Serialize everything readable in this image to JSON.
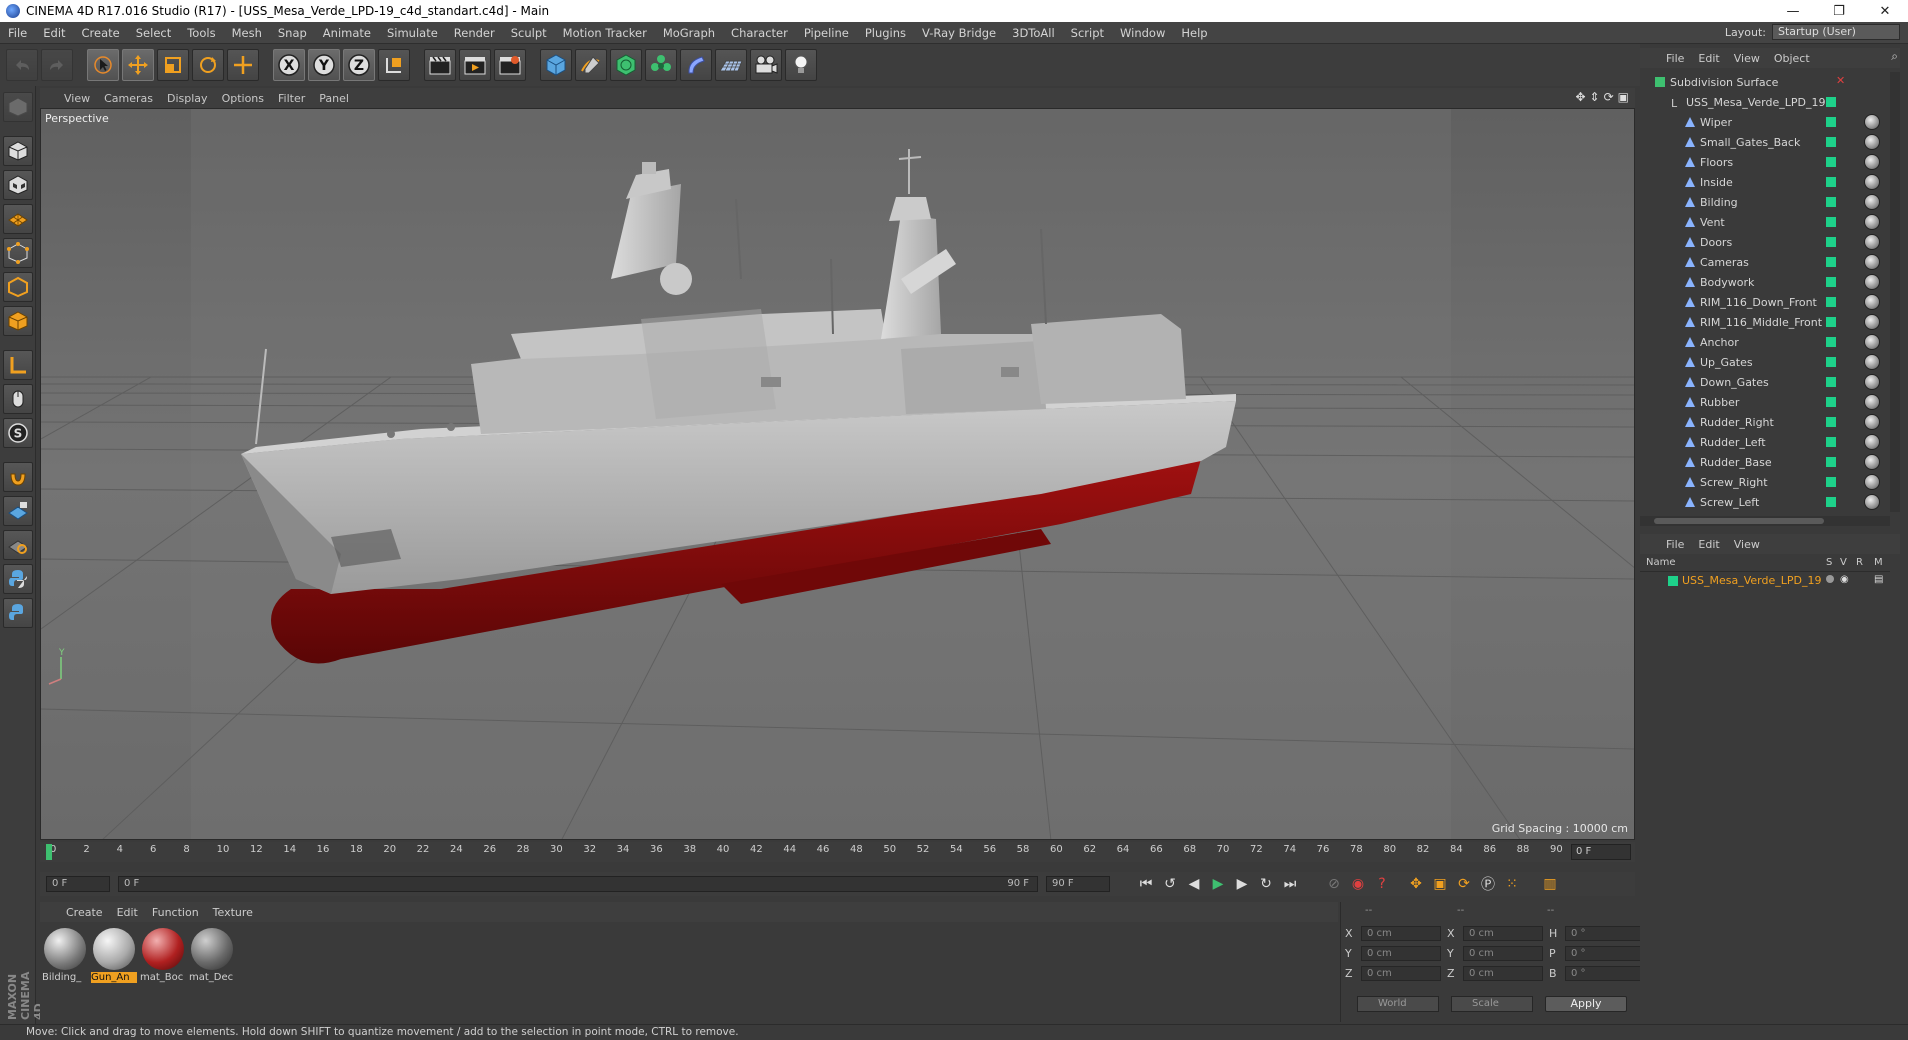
{
  "window": {
    "title": "CINEMA 4D R17.016 Studio (R17) - [USS_Mesa_Verde_LPD-19_c4d_standart.c4d] - Main",
    "minimize": "—",
    "restore": "❐",
    "close": "✕"
  },
  "menu": [
    "File",
    "Edit",
    "Create",
    "Select",
    "Tools",
    "Mesh",
    "Snap",
    "Animate",
    "Simulate",
    "Render",
    "Sculpt",
    "Motion Tracker",
    "MoGraph",
    "Character",
    "Pipeline",
    "Plugins",
    "V-Ray Bridge",
    "3DToAll",
    "Script",
    "Window",
    "Help"
  ],
  "layout": {
    "label": "Layout:",
    "value": "Startup (User)"
  },
  "viewport": {
    "menu": [
      "View",
      "Cameras",
      "Display",
      "Options",
      "Filter",
      "Panel"
    ],
    "label": "Perspective",
    "grid_spacing": "Grid Spacing : 10000 cm"
  },
  "timeline": {
    "ticks": [
      "0",
      "2",
      "4",
      "6",
      "8",
      "10",
      "12",
      "14",
      "16",
      "18",
      "20",
      "22",
      "24",
      "26",
      "28",
      "30",
      "32",
      "34",
      "36",
      "38",
      "40",
      "42",
      "44",
      "46",
      "48",
      "50",
      "52",
      "54",
      "56",
      "58",
      "60",
      "62",
      "64",
      "66",
      "68",
      "70",
      "72",
      "74",
      "76",
      "78",
      "80",
      "82",
      "84",
      "86",
      "88",
      "90"
    ],
    "current": "0 F",
    "start": "0 F",
    "range_start": "0 F",
    "range_end": "90 F",
    "end": "90 F"
  },
  "materials": {
    "menu": [
      "Create",
      "Edit",
      "Function",
      "Texture"
    ],
    "items": [
      {
        "label": "Bilding_",
        "selected": false
      },
      {
        "label": "Gun_An",
        "selected": true
      },
      {
        "label": "mat_Boc",
        "selected": false
      },
      {
        "label": "mat_Dec",
        "selected": false
      }
    ]
  },
  "coords": {
    "header": [
      "--",
      "--",
      "--"
    ],
    "rows": [
      {
        "a1": "X",
        "v1": "0 cm",
        "a2": "X",
        "v2": "0 cm",
        "a3": "H",
        "v3": "0 °"
      },
      {
        "a1": "Y",
        "v1": "0 cm",
        "a2": "Y",
        "v2": "0 cm",
        "a3": "P",
        "v3": "0 °"
      },
      {
        "a1": "Z",
        "v1": "0 cm",
        "a2": "Z",
        "v2": "0 cm",
        "a3": "B",
        "v3": "0 °"
      }
    ],
    "world": "World",
    "scale": "Scale",
    "apply": "Apply"
  },
  "objects": {
    "menu": [
      "File",
      "Edit",
      "View",
      "Object"
    ],
    "root": "Subdivision Surface",
    "group": "USS_Mesa_Verde_LPD_19",
    "children": [
      "Wiper",
      "Small_Gates_Back",
      "Floors",
      "Inside",
      "Bilding",
      "Vent",
      "Doors",
      "Cameras",
      "Bodywork",
      "RIM_116_Down_Front",
      "RIM_116_Middle_Front",
      "Anchor",
      "Up_Gates",
      "Down_Gates",
      "Rubber",
      "Rudder_Right",
      "Rudder_Left",
      "Rudder_Base",
      "Screw_Right",
      "Screw_Left"
    ]
  },
  "layers": {
    "menu": [
      "File",
      "Edit",
      "View"
    ],
    "columns": [
      "Name",
      "S",
      "V",
      "R",
      "M"
    ],
    "row": "USS_Mesa_Verde_LPD_19"
  },
  "status": "Move: Click and drag to move elements. Hold down SHIFT to quantize movement / add to the selection in point mode, CTRL to remove.",
  "brand": "MAXON CINEMA 4D",
  "colors": {
    "accent": "#f0a020",
    "green": "#1ed18a",
    "hull_red": "#8e0d0d",
    "hull_gray": "#b4b4b4"
  }
}
